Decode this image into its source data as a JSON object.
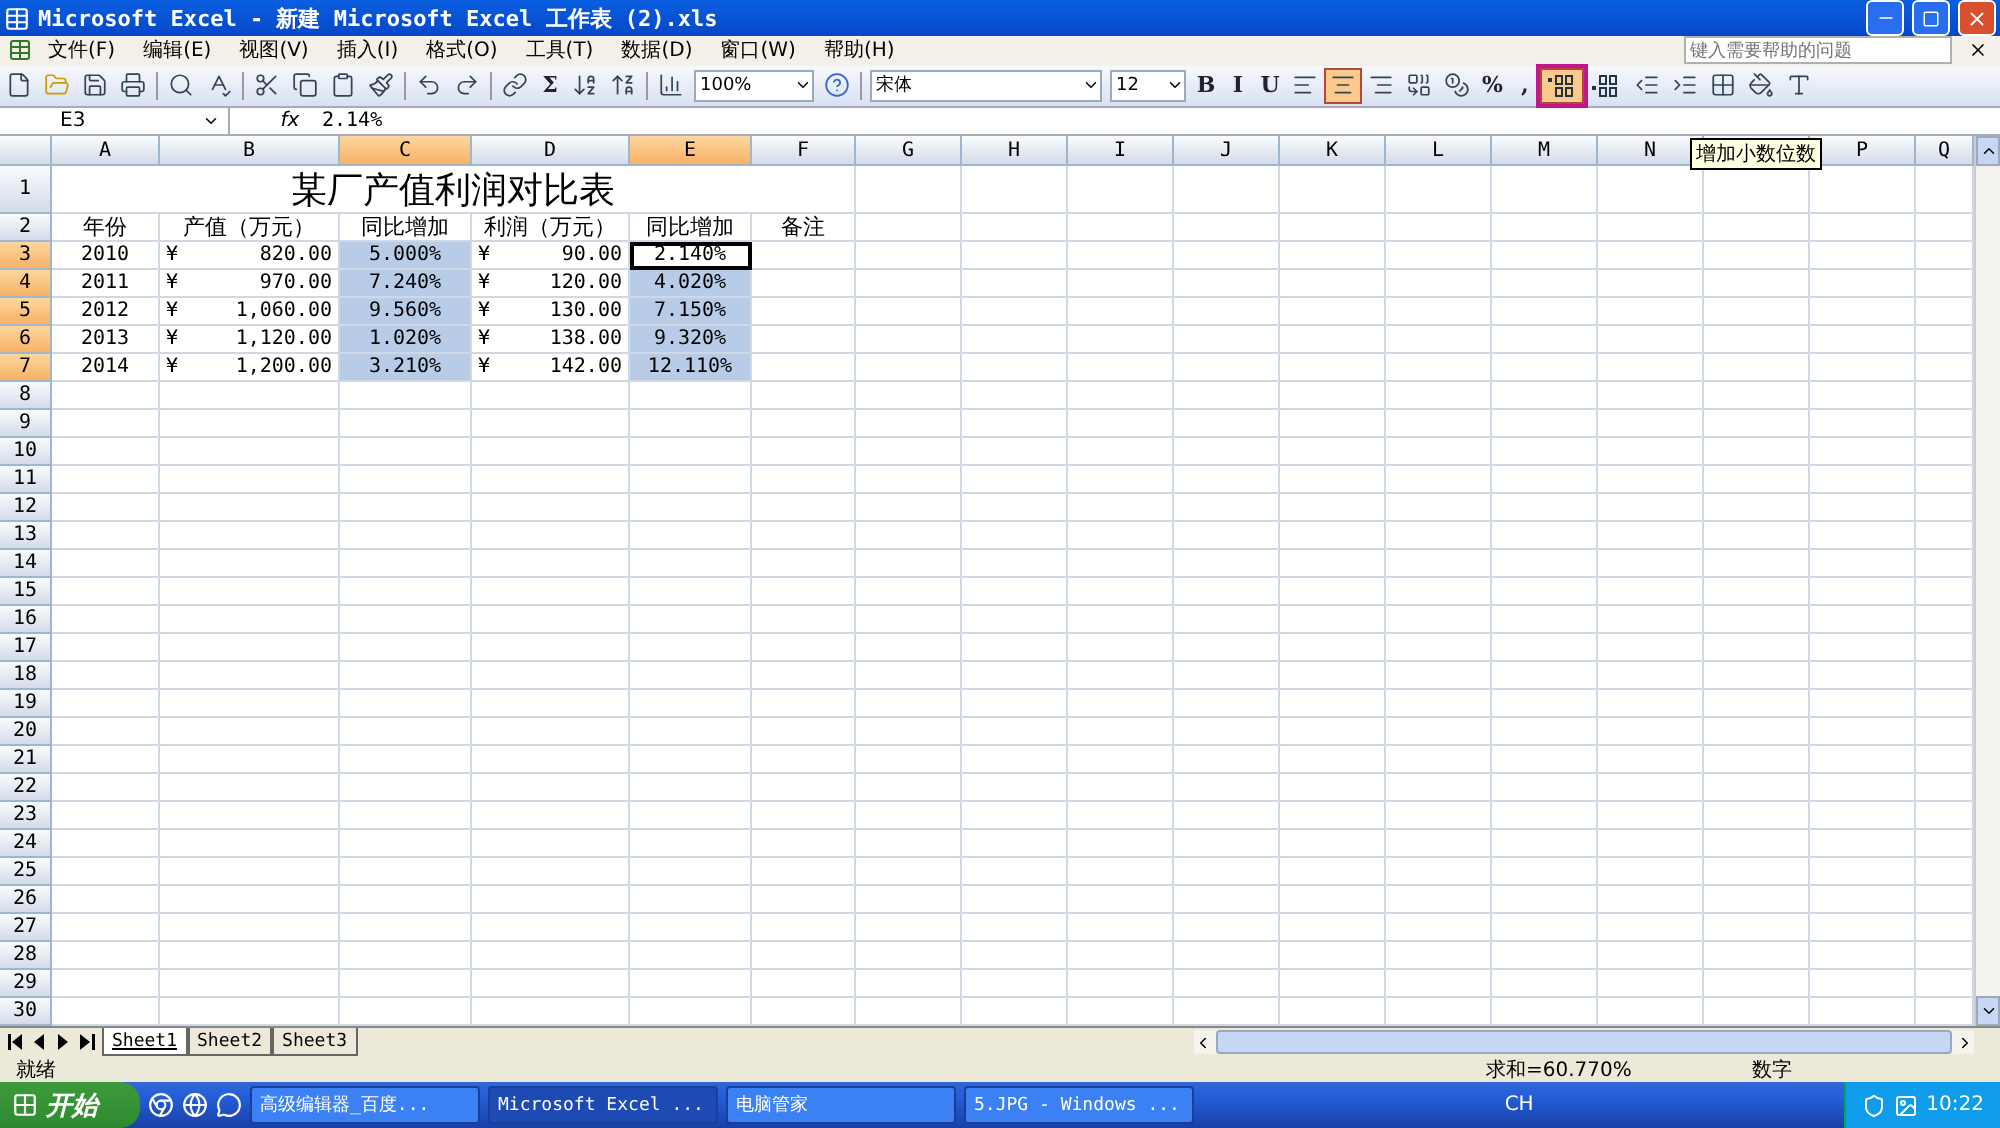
{
  "window": {
    "title": "Microsoft Excel - 新建 Microsoft Excel 工作表 (2).xls"
  },
  "menu": [
    "文件(F)",
    "编辑(E)",
    "视图(V)",
    "插入(I)",
    "格式(O)",
    "工具(T)",
    "数据(D)",
    "窗口(W)",
    "帮助(H)"
  ],
  "help_box": {
    "placeholder": "键入需要帮助的问题"
  },
  "standard_toolbar": {
    "sum": "Σ",
    "zoom": "100%"
  },
  "format_toolbar": {
    "font": "宋体",
    "size": "12",
    "buttons": [
      {
        "kind": "text",
        "label": "B",
        "selected": false
      },
      {
        "kind": "text",
        "label": "I",
        "selected": false
      },
      {
        "kind": "text",
        "label": "U",
        "selected": false
      },
      {
        "kind": "align-left",
        "selected": false
      },
      {
        "kind": "align-center",
        "selected": true
      },
      {
        "kind": "align-right",
        "selected": false
      },
      {
        "kind": "merge",
        "selected": false
      },
      {
        "kind": "currency",
        "selected": false
      },
      {
        "kind": "text",
        "label": "%",
        "selected": false
      },
      {
        "kind": "text",
        "label": ",",
        "selected": false
      },
      {
        "kind": "increase-decimal",
        "selected": true
      },
      {
        "kind": "decrease-decimal",
        "selected": false
      },
      {
        "kind": "outdent",
        "selected": false
      },
      {
        "kind": "indent",
        "selected": false
      },
      {
        "kind": "borders",
        "selected": false
      },
      {
        "kind": "fill",
        "selected": false
      },
      {
        "kind": "font-color",
        "selected": false
      }
    ]
  },
  "tooltip": "增加小数位数",
  "formula_bar": {
    "name_box": "E3",
    "fx": "fx",
    "formula": "2.14%"
  },
  "columns": [
    {
      "label": "A",
      "selected": false
    },
    {
      "label": "B",
      "selected": false
    },
    {
      "label": "C",
      "selected": true
    },
    {
      "label": "D",
      "selected": false
    },
    {
      "label": "E",
      "selected": true
    },
    {
      "label": "F",
      "selected": false
    },
    {
      "label": "G",
      "selected": false
    },
    {
      "label": "H",
      "selected": false
    },
    {
      "label": "I",
      "selected": false
    },
    {
      "label": "J",
      "selected": false
    },
    {
      "label": "K",
      "selected": false
    },
    {
      "label": "L",
      "selected": false
    },
    {
      "label": "M",
      "selected": false
    },
    {
      "label": "N",
      "selected": false
    },
    {
      "selected": false
    },
    {
      "label": "P",
      "selected": false
    },
    {
      "label": "Q",
      "selected": false
    }
  ],
  "title_row": {
    "number": "1",
    "selected": false,
    "text": "某厂产值利润对比表"
  },
  "rows": [
    {
      "number": "2",
      "selected": false,
      "cells": [
        {
          "kind": "header",
          "text": "年份",
          "selected": false,
          "active": false
        },
        {
          "kind": "header",
          "text": "产值（万元）",
          "selected": false,
          "active": false
        },
        {
          "kind": "header",
          "text": "同比增加",
          "selected": false,
          "active": false
        },
        {
          "kind": "header",
          "text": "利润（万元）",
          "selected": false,
          "active": false
        },
        {
          "kind": "header",
          "text": "同比增加",
          "selected": false,
          "active": false
        },
        {
          "kind": "header",
          "text": "备注",
          "selected": false,
          "active": false
        }
      ]
    },
    {
      "number": "3",
      "selected": true,
      "cells": [
        {
          "kind": "year",
          "text": "2010",
          "selected": false,
          "active": false
        },
        {
          "kind": "money",
          "currency": "¥",
          "text": "820.00",
          "selected": false,
          "active": false
        },
        {
          "kind": "percent",
          "text": "5.000%",
          "selected": true,
          "active": false
        },
        {
          "kind": "money",
          "currency": "¥",
          "text": "90.00",
          "selected": false,
          "active": false
        },
        {
          "kind": "percent",
          "text": "2.140%",
          "selected": true,
          "active": true
        },
        {
          "kind": "empty",
          "selected": false,
          "active": false
        }
      ]
    },
    {
      "number": "4",
      "selected": true,
      "cells": [
        {
          "kind": "year",
          "text": "2011",
          "selected": false,
          "active": false
        },
        {
          "kind": "money",
          "currency": "¥",
          "text": "970.00",
          "selected": false,
          "active": false
        },
        {
          "kind": "percent",
          "text": "7.240%",
          "selected": true,
          "active": false
        },
        {
          "kind": "money",
          "currency": "¥",
          "text": "120.00",
          "selected": false,
          "active": false
        },
        {
          "kind": "percent",
          "text": "4.020%",
          "selected": true,
          "active": false
        },
        {
          "kind": "empty",
          "selected": false,
          "active": false
        }
      ]
    },
    {
      "number": "5",
      "selected": true,
      "cells": [
        {
          "kind": "year",
          "text": "2012",
          "selected": false,
          "active": false
        },
        {
          "kind": "money",
          "currency": "¥",
          "text": "1,060.00",
          "selected": false,
          "active": false
        },
        {
          "kind": "percent",
          "text": "9.560%",
          "selected": true,
          "active": false
        },
        {
          "kind": "money",
          "currency": "¥",
          "text": "130.00",
          "selected": false,
          "active": false
        },
        {
          "kind": "percent",
          "text": "7.150%",
          "selected": true,
          "active": false
        },
        {
          "kind": "empty",
          "selected": false,
          "active": false
        }
      ]
    },
    {
      "number": "6",
      "selected": true,
      "cells": [
        {
          "kind": "year",
          "text": "2013",
          "selected": false,
          "active": false
        },
        {
          "kind": "money",
          "currency": "¥",
          "text": "1,120.00",
          "selected": false,
          "active": false
        },
        {
          "kind": "percent",
          "text": "1.020%",
          "selected": true,
          "active": false
        },
        {
          "kind": "money",
          "currency": "¥",
          "text": "138.00",
          "selected": false,
          "active": false
        },
        {
          "kind": "percent",
          "text": "9.320%",
          "selected": true,
          "active": false
        },
        {
          "kind": "empty",
          "selected": false,
          "active": false
        }
      ]
    },
    {
      "number": "7",
      "selected": true,
      "cells": [
        {
          "kind": "year",
          "text": "2014",
          "selected": false,
          "active": false
        },
        {
          "kind": "money",
          "currency": "¥",
          "text": "1,200.00",
          "selected": false,
          "active": false
        },
        {
          "kind": "percent",
          "text": "3.210%",
          "selected": true,
          "active": false
        },
        {
          "kind": "money",
          "currency": "¥",
          "text": "142.00",
          "selected": false,
          "active": false
        },
        {
          "kind": "percent",
          "text": "12.110%",
          "selected": true,
          "active": false
        },
        {
          "kind": "empty",
          "selected": false,
          "active": false
        }
      ]
    }
  ],
  "empty_rows": [
    "8",
    "9",
    "10",
    "11",
    "12",
    "13",
    "14",
    "15",
    "16",
    "17",
    "18",
    "19",
    "20",
    "21",
    "22",
    "23",
    "24",
    "25",
    "26",
    "27",
    "28",
    "29",
    "30"
  ],
  "sheet_tabs": [
    {
      "label": "Sheet1",
      "selected": true
    },
    {
      "label": "Sheet2",
      "selected": false
    },
    {
      "label": "Sheet3",
      "selected": false
    }
  ],
  "status_bar": {
    "state": "就绪",
    "sum": "求和=60.770%",
    "mode": "数字"
  },
  "taskbar": {
    "start": "开始",
    "tasks": [
      {
        "label": "高级编辑器_百度...",
        "selected": false
      },
      {
        "label": "Microsoft Excel ...",
        "selected": true
      },
      {
        "label": "电脑管家",
        "selected": false
      },
      {
        "label": "5.JPG - Windows ...",
        "selected": false
      }
    ],
    "language": "CH",
    "clock": "10:22"
  }
}
